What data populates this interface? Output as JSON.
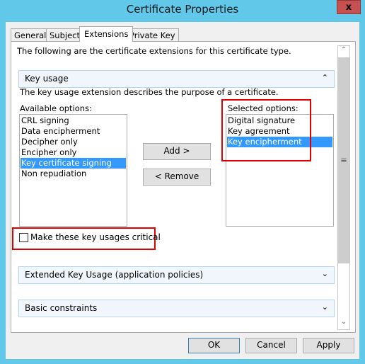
{
  "window": {
    "title": "Certificate Properties",
    "close": "x"
  },
  "tabs": [
    {
      "label": "General"
    },
    {
      "label": "Subject"
    },
    {
      "label": "Extensions",
      "active": true
    },
    {
      "label": "Private Key"
    }
  ],
  "intro": "The following are the certificate extensions for this certificate type.",
  "key_usage": {
    "header": "Key usage",
    "description": "The key usage extension describes the purpose of a certificate.",
    "available_label": "Available options:",
    "available": [
      "CRL signing",
      "Data encipherment",
      "Decipher only",
      "Encipher only",
      "Key certificate signing",
      "Non repudiation"
    ],
    "available_selected": "Key certificate signing",
    "selected_label": "Selected options:",
    "selected": [
      "Digital signature",
      "Key agreement",
      "Key encipherment"
    ],
    "selected_selected": "Key encipherment",
    "add": "Add >",
    "remove": "< Remove",
    "critical_label": "Make these key usages critical",
    "critical_checked": false
  },
  "sections": [
    {
      "header": "Extended Key Usage (application policies)"
    },
    {
      "header": "Basic constraints"
    }
  ],
  "buttons": {
    "ok": "OK",
    "cancel": "Cancel",
    "apply": "Apply"
  },
  "colors": {
    "frame": "#62c8ea",
    "close": "#c75050",
    "selection": "#3399ff",
    "highlight": "#e00000"
  }
}
